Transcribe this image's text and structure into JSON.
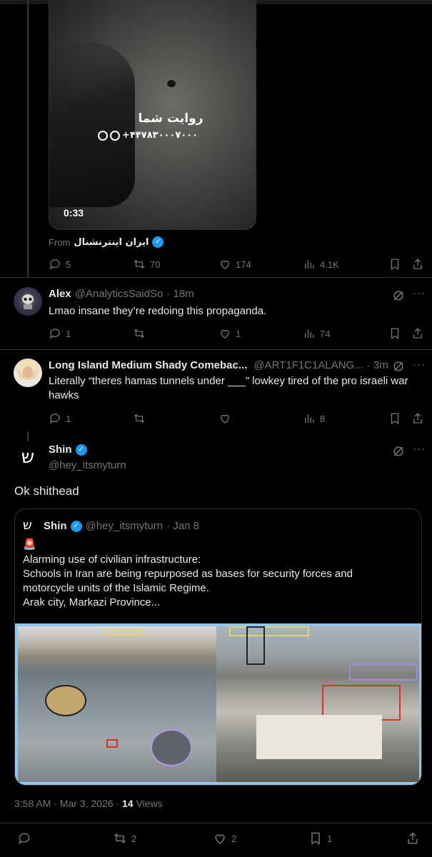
{
  "video": {
    "watermark_title": "روایت شما",
    "watermark_contact": "+۴۴۷۸۳۰۰۰۷۰۰۰",
    "duration": "0:33"
  },
  "from_label": "From",
  "from_source": "ایران اینترنشنال",
  "top_post_actions": {
    "replies": "5",
    "reposts": "70",
    "likes": "174",
    "views": "4.1K"
  },
  "replies": [
    {
      "name": "Alex",
      "handle": "@AnalyticsSaidSo",
      "time": "· 18m",
      "text": "Lmao insane they’re redoing this propaganda.",
      "actions": {
        "replies": "1",
        "reposts": "",
        "likes": "1",
        "views": "74"
      }
    },
    {
      "name": "Long Island Medium Shady Comebac...",
      "handle": "@ART1F1C1ALANG...",
      "time": "· 3m",
      "text": "Literally “theres hamas tunnels under ___” lowkey tired of the pro israeli war hawks",
      "actions": {
        "replies": "1",
        "reposts": "",
        "likes": "",
        "views": "8"
      }
    }
  ],
  "main_post": {
    "avatar_glyph": "ש",
    "name": "Shin",
    "handle": "@hey_itsmyturn",
    "text": "Ok shithead",
    "timestamp": "3:58 AM · Mar 3, 2026 ·",
    "views_count": "14",
    "views_label": "Views",
    "actions": {
      "replies": "",
      "reposts": "2",
      "likes": "2",
      "bookmarks": "1"
    }
  },
  "quote": {
    "avatar_glyph": "ש",
    "name": "Shin",
    "handle": "@hey_itsmyturn",
    "date": "· Jan 8",
    "emoji": "🚨",
    "lines": [
      "Alarming use of civilian infrastructure:",
      "Schools in Iran are being repurposed as bases for security forces and",
      "motorcycle units of the Islamic Regime.",
      "Arak city, Markazi Province..."
    ]
  },
  "colors": {
    "accent": "#1d9bf0",
    "muted": "#71767b",
    "border": "#2f3336"
  }
}
